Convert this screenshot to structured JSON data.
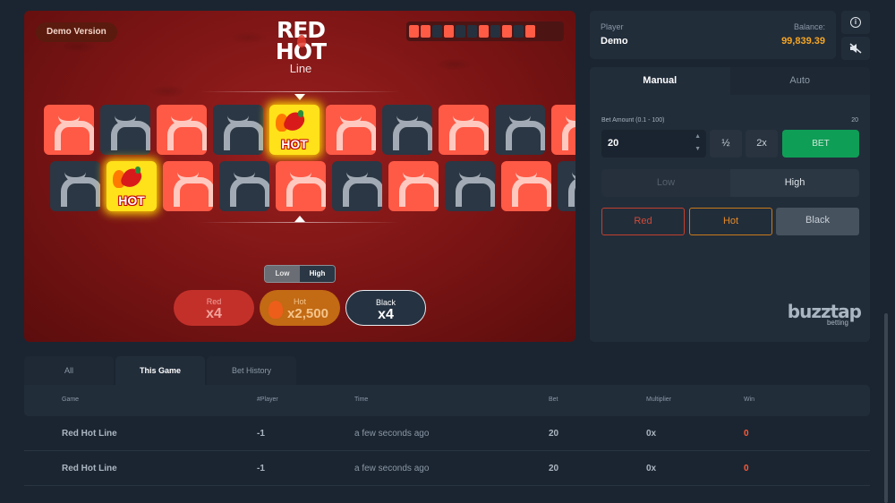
{
  "game": {
    "demo_label": "Demo Version",
    "logo": {
      "line1": "RED",
      "line2": "HOT",
      "line3": "Line"
    },
    "history": [
      "red",
      "red",
      "black",
      "red",
      "black",
      "black",
      "red",
      "black",
      "red",
      "black",
      "red"
    ],
    "row1": [
      {
        "type": "red"
      },
      {
        "type": "black"
      },
      {
        "type": "red"
      },
      {
        "type": "black"
      },
      {
        "type": "hot"
      },
      {
        "type": "red"
      },
      {
        "type": "black"
      },
      {
        "type": "red"
      },
      {
        "type": "black"
      },
      {
        "type": "red"
      }
    ],
    "row2": [
      {
        "type": "black"
      },
      {
        "type": "hot"
      },
      {
        "type": "red"
      },
      {
        "type": "black"
      },
      {
        "type": "red"
      },
      {
        "type": "black"
      },
      {
        "type": "red"
      },
      {
        "type": "black"
      },
      {
        "type": "red"
      },
      {
        "type": "black"
      }
    ],
    "hot_label": "HOT",
    "toggle": {
      "low": "Low",
      "high": "High",
      "active": "high"
    },
    "bets": [
      {
        "name": "Red",
        "multiplier": "x4"
      },
      {
        "name": "Hot",
        "multiplier": "x2,500"
      },
      {
        "name": "Black",
        "multiplier": "x4"
      }
    ]
  },
  "player": {
    "label": "Player",
    "name": "Demo",
    "balance_label": "Balance:",
    "balance": "99,839.39",
    "balance_color": "#f5a623"
  },
  "icons": {
    "info": "info-icon",
    "mute": "sound-off-icon"
  },
  "panel": {
    "tabs": [
      "Manual",
      "Auto"
    ],
    "active_tab": "Manual",
    "bet_amount_label": "Bet Amount (0.1 - 100)",
    "bet_max": "20",
    "bet_amount_value": "20",
    "half_label": "½",
    "double_label": "2x",
    "bet_button": "BET",
    "low_label": "Low",
    "high_label": "High",
    "choices": [
      "Red",
      "Hot",
      "Black"
    ],
    "brand_main": "buzztap",
    "brand_sub": "betting"
  },
  "history_table": {
    "tabs": [
      "All",
      "This Game",
      "Bet History"
    ],
    "active_tab": "This Game",
    "columns": [
      "Game",
      "#Player",
      "Time",
      "Bet",
      "Multiplier",
      "Win"
    ],
    "rows": [
      {
        "game": "Red Hot Line",
        "player": "-1",
        "time": "a few seconds ago",
        "bet": "20",
        "multiplier": "0x",
        "win": "0"
      },
      {
        "game": "Red Hot Line",
        "player": "-1",
        "time": "a few seconds ago",
        "bet": "20",
        "multiplier": "0x",
        "win": "0"
      }
    ]
  },
  "colors": {
    "accent_green": "#0f9e56",
    "red": "#ff5a46",
    "hot": "#ffe21a",
    "background": "#1b2531"
  }
}
